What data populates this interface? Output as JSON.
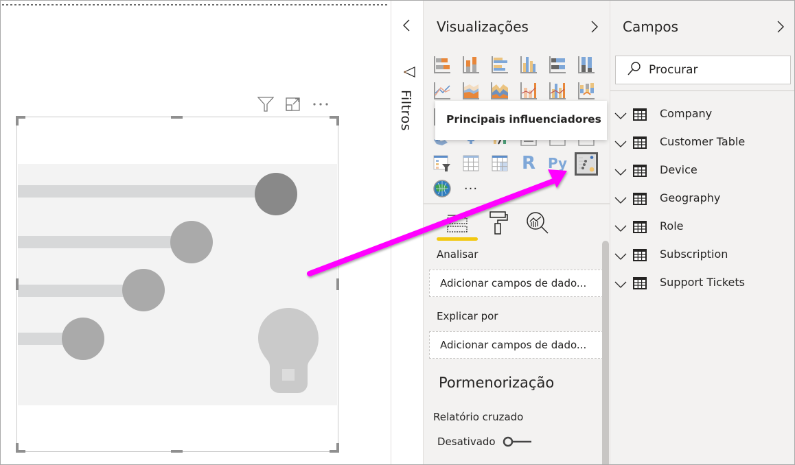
{
  "canvas": {
    "visual_header": {
      "filter_icon": "filter-icon",
      "focus_icon": "focus-mode-icon",
      "more_icon": "more-options-icon"
    },
    "placeholder_visual": "key-influencers-placeholder"
  },
  "filters": {
    "label": "Filtros",
    "collapse_icon": "chevron-left-icon",
    "icon": "filter-icon"
  },
  "visualizations": {
    "title": "Visualizações",
    "expand_icon": "chevron-right-icon",
    "tooltip": "Principais influenciadores",
    "icons": [
      "stacked-bar-chart",
      "stacked-column-chart",
      "clustered-bar-chart",
      "clustered-column-chart",
      "100-stacked-bar-chart",
      "100-stacked-column-chart",
      "line-chart",
      "area-chart",
      "stacked-area-chart",
      "line-and-stacked-column-chart",
      "line-and-clustered-column-chart",
      "ribbon-chart",
      "waterfall-chart",
      "funnel-chart",
      "scatter-chart",
      "pie-chart",
      "donut-chart",
      "treemap",
      "map",
      "filled-map",
      "gauge",
      "card",
      "multi-row-card",
      "kpi",
      "slicer",
      "table",
      "matrix",
      "r-script-visual",
      "python-visual",
      "key-influencers",
      "arcgis-map",
      "more-visuals"
    ],
    "r_label": "R",
    "py_label": "Py",
    "more_label": "···",
    "selected_icon": "key-influencers",
    "tabs": [
      "fields-tab",
      "format-tab",
      "analytics-tab"
    ],
    "active_tab": "fields-tab",
    "wells": [
      {
        "label": "Analisar",
        "placeholder": "Adicionar campos de dado..."
      },
      {
        "label": "Explicar por",
        "placeholder": "Adicionar campos de dado..."
      }
    ],
    "drillthrough": {
      "heading": "Pormenorização",
      "cross_report_label": "Relatório cruzado",
      "toggle_label": "Desativado",
      "toggle_on": false
    }
  },
  "fields": {
    "title": "Campos",
    "expand_icon": "chevron-right-icon",
    "search_placeholder": "Procurar",
    "tables": [
      {
        "name": "Company"
      },
      {
        "name": "Customer Table"
      },
      {
        "name": "Device"
      },
      {
        "name": "Geography"
      },
      {
        "name": "Role"
      },
      {
        "name": "Subscription"
      },
      {
        "name": "Support Tickets"
      }
    ]
  },
  "annotation": {
    "arrow_color": "#ff00ff"
  },
  "colors": {
    "accent_yellow": "#f2c811",
    "pane_bg": "#f3f2f1",
    "chart_orange": "#e8873a",
    "chart_blue": "#7ea7d8",
    "chart_tan": "#ebc37f"
  }
}
